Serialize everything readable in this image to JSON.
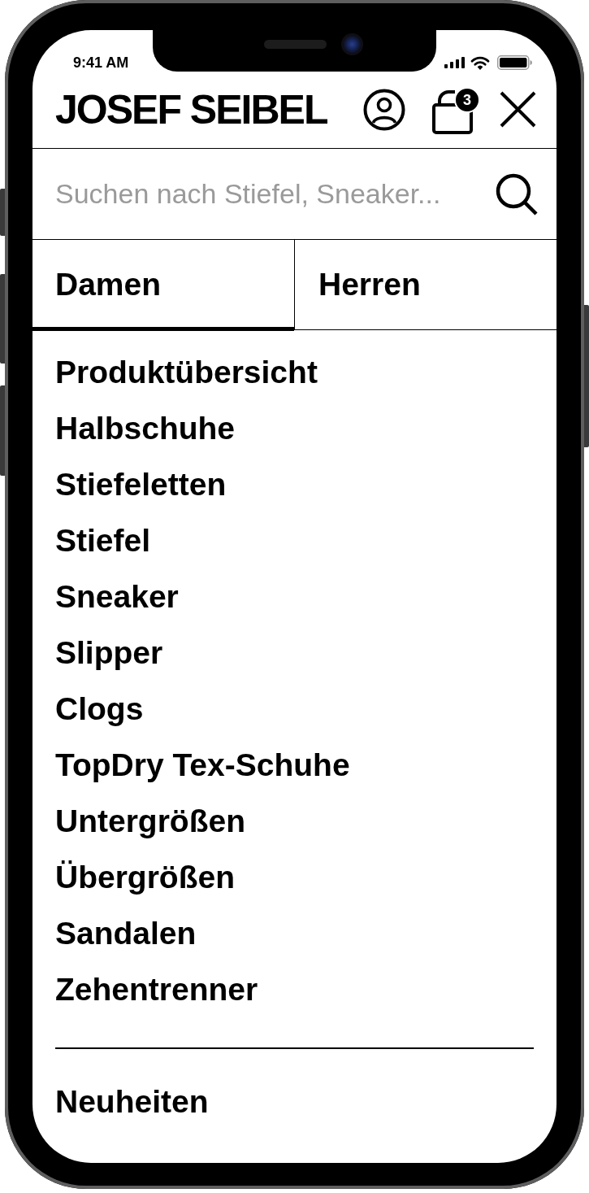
{
  "status_bar": {
    "time": "9:41 AM"
  },
  "header": {
    "logo": "JOSEF SEIBEL",
    "cart_count": "3"
  },
  "search": {
    "placeholder": "Suchen nach Stiefel, Sneaker..."
  },
  "tabs": [
    {
      "label": "Damen",
      "selected": true
    },
    {
      "label": "Herren",
      "selected": false
    }
  ],
  "categories": [
    "Produktübersicht",
    "Halbschuhe",
    "Stiefeletten",
    "Stiefel",
    "Sneaker",
    "Slipper",
    "Clogs",
    "TopDry Tex-Schuhe",
    "Untergrößen",
    "Übergrößen",
    "Sandalen",
    "Zehentrenner"
  ],
  "extra_links": [
    "Neuheiten"
  ]
}
